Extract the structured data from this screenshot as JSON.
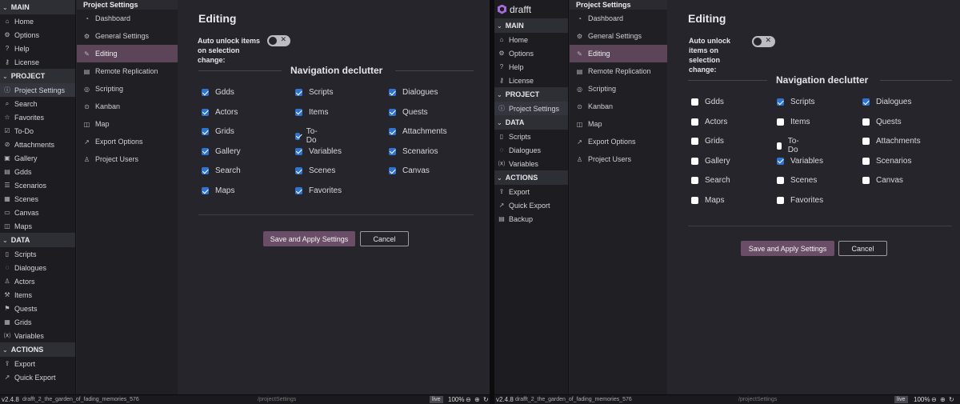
{
  "brand": "drafft",
  "settings_title": "Project Settings",
  "sidebar": {
    "sections": {
      "main": "MAIN",
      "project": "PROJECT",
      "data": "DATA",
      "actions": "ACTIONS"
    },
    "main_items": [
      "Home",
      "Options",
      "Help",
      "License"
    ],
    "project_items_a": [
      "Project Settings",
      "Search",
      "Favorites",
      "To-Do",
      "Attachments",
      "Gallery",
      "Gdds",
      "Scenarios",
      "Scenes",
      "Canvas",
      "Maps"
    ],
    "project_items_b": [
      "Project Settings"
    ],
    "data_items_a": [
      "Scripts",
      "Dialogues",
      "Actors",
      "Items",
      "Quests",
      "Grids",
      "Variables"
    ],
    "data_items_b": [
      "Scripts",
      "Dialogues",
      "Variables"
    ],
    "actions_items_a": [
      "Export",
      "Quick Export"
    ],
    "actions_items_b": [
      "Export",
      "Quick Export",
      "Backup"
    ]
  },
  "settings_nav": [
    "Dashboard",
    "General Settings",
    "Editing",
    "Remote Replication",
    "Scripting",
    "Kanban",
    "Map",
    "Export Options",
    "Project Users"
  ],
  "page": {
    "title": "Editing",
    "auto_unlock_label": "Auto unlock items on selection change:",
    "declutter_title": "Navigation declutter",
    "save_label": "Save and Apply Settings",
    "cancel_label": "Cancel"
  },
  "declutter_a": {
    "col1": [
      [
        "Gdds",
        true
      ],
      [
        "Actors",
        true
      ],
      [
        "Grids",
        true
      ],
      [
        "Gallery",
        true
      ],
      [
        "Search",
        true
      ],
      [
        "Maps",
        true
      ]
    ],
    "col2": [
      [
        "Scripts",
        true
      ],
      [
        "Items",
        true
      ],
      [
        "To-Do",
        true
      ],
      [
        "Variables",
        true
      ],
      [
        "Scenes",
        true
      ],
      [
        "Favorites",
        true
      ]
    ],
    "col3": [
      [
        "Dialogues",
        true
      ],
      [
        "Quests",
        true
      ],
      [
        "Attachments",
        true
      ],
      [
        "Scenarios",
        true
      ],
      [
        "Canvas",
        true
      ]
    ]
  },
  "declutter_b": {
    "col1": [
      [
        "Gdds",
        false
      ],
      [
        "Actors",
        false
      ],
      [
        "Grids",
        false
      ],
      [
        "Gallery",
        false
      ],
      [
        "Search",
        false
      ],
      [
        "Maps",
        false
      ]
    ],
    "col2": [
      [
        "Scripts",
        true
      ],
      [
        "Items",
        false
      ],
      [
        "To-Do",
        false
      ],
      [
        "Variables",
        true
      ],
      [
        "Scenes",
        false
      ],
      [
        "Favorites",
        false
      ]
    ],
    "col3": [
      [
        "Dialogues",
        true
      ],
      [
        "Quests",
        false
      ],
      [
        "Attachments",
        false
      ],
      [
        "Scenarios",
        false
      ],
      [
        "Canvas",
        false
      ]
    ]
  },
  "status": {
    "version": "v2.4.8",
    "project": "drafft_2_the_garden_of_fading_memories_576",
    "path": "/projectSettings",
    "live": "live",
    "zoom": "100%"
  },
  "icons": {
    "main": [
      "home-icon",
      "gear-icon",
      "help-icon",
      "key-icon"
    ],
    "project": [
      "info-icon",
      "search-icon",
      "star-icon",
      "todo-icon",
      "paperclip-icon",
      "gallery-icon",
      "document-icon",
      "scenarios-icon",
      "scenes-icon",
      "canvas-icon",
      "map-icon"
    ],
    "data": [
      "script-icon",
      "dialogue-icon",
      "actor-icon",
      "item-icon",
      "quest-icon",
      "grid-icon",
      "variable-icon"
    ],
    "actions": [
      "export-icon",
      "quick-export-icon",
      "backup-icon"
    ],
    "settings": [
      "dashboard-icon",
      "gear-icon",
      "edit-icon",
      "replication-icon",
      "scripting-icon",
      "kanban-icon",
      "map-icon",
      "export-options-icon",
      "users-icon"
    ]
  },
  "accent": "#5c4459"
}
